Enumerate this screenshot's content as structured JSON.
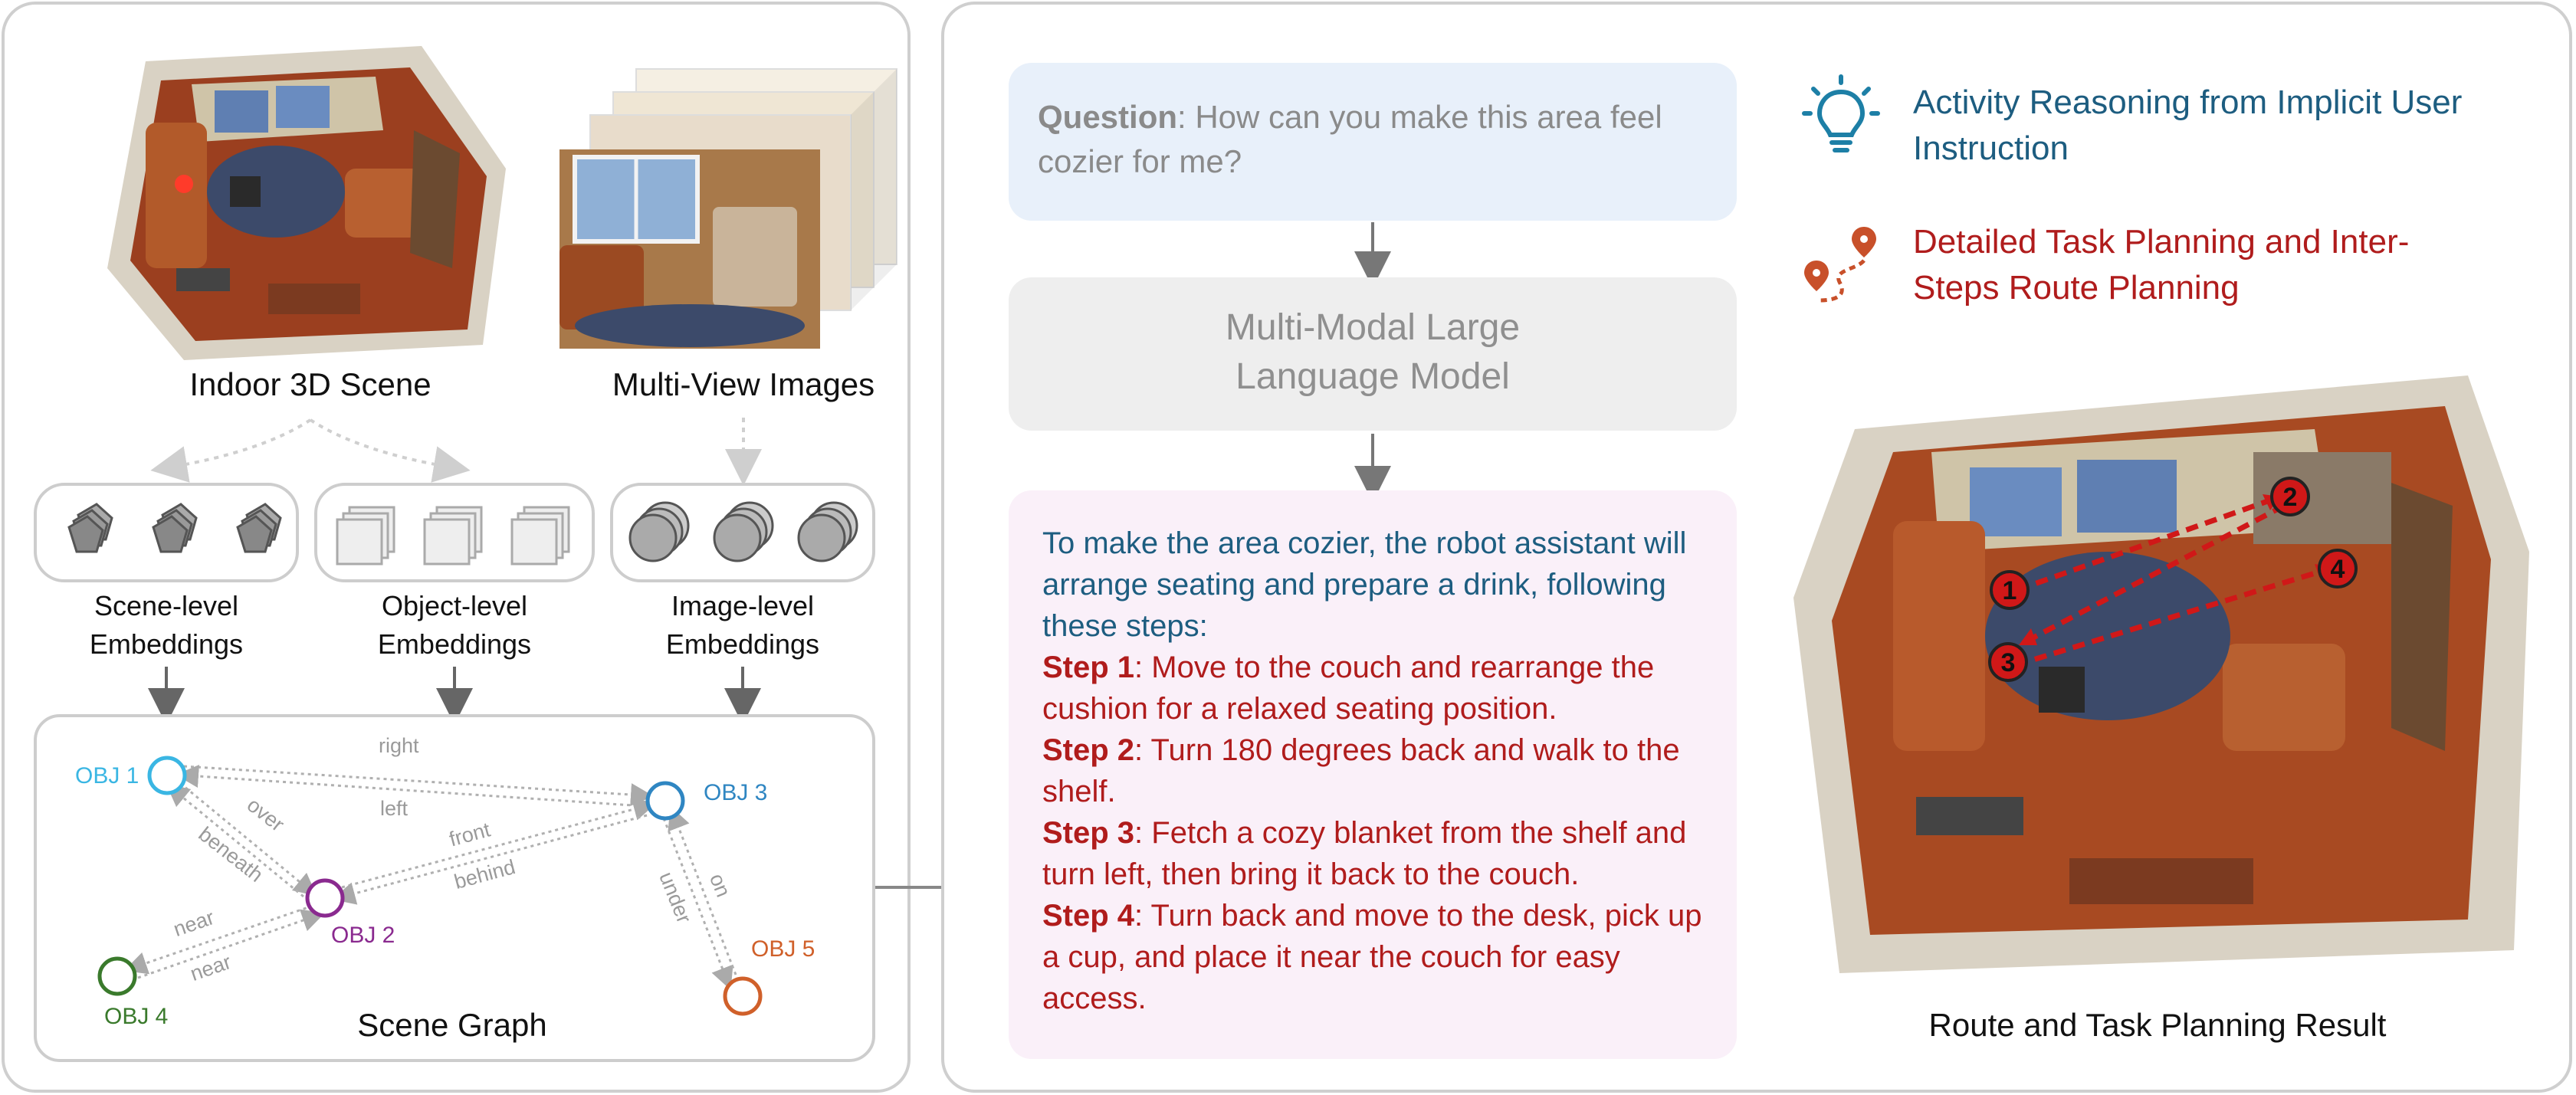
{
  "left_panel": {
    "scene_caption": "Indoor 3D Scene",
    "multiview_caption": "Multi-View Images",
    "embeddings": [
      {
        "line1": "Scene-level",
        "line2": "Embeddings"
      },
      {
        "line1": "Object-level",
        "line2": "Embeddings"
      },
      {
        "line1": "Image-level",
        "line2": "Embeddings"
      }
    ],
    "scene_graph": {
      "title": "Scene Graph",
      "nodes": [
        {
          "label": "OBJ 1",
          "color": "#3ab6e3"
        },
        {
          "label": "OBJ 2",
          "color": "#8a2a8f"
        },
        {
          "label": "OBJ 3",
          "color": "#2f86c2"
        },
        {
          "label": "OBJ 4",
          "color": "#3a7a2c"
        },
        {
          "label": "OBJ 5",
          "color": "#d0602a"
        }
      ],
      "edges": {
        "right": "right",
        "left": "left",
        "over": "over",
        "beneath": "beneath",
        "front": "front",
        "behind": "behind",
        "near_a": "near",
        "near_b": "near",
        "on": "on",
        "under": "under"
      }
    }
  },
  "right_panel": {
    "question": {
      "prefix": "Question",
      "text": ": How can you make this area feel cozier for me?"
    },
    "model_line1": "Multi-Modal Large",
    "model_line2": "Language Model",
    "answer": {
      "intro": "To make the area cozier, the robot assistant will arrange seating and prepare a drink, following these steps:",
      "steps": [
        {
          "label": "Step 1",
          "text": ": Move to the couch and rearrange the cushion for a relaxed seating position."
        },
        {
          "label": "Step 2",
          "text": ": Turn 180 degrees back and walk to the shelf."
        },
        {
          "label": "Step 3",
          "text": ": Fetch a cozy blanket from the shelf and turn left, then bring it back to the couch."
        },
        {
          "label": "Step 4",
          "text": ": Turn back and move to the desk, pick up a cup, and place it near the couch for easy access."
        }
      ]
    },
    "legend": [
      {
        "icon": "lightbulb-icon",
        "text": "Activity Reasoning from Implicit User Instruction",
        "color": "#1d5d80"
      },
      {
        "icon": "route-icon",
        "text": "Detailed Task Planning and Inter-Steps Route Planning",
        "color": "#b01c1c"
      }
    ],
    "result_caption": "Route and Task Planning Result",
    "route_markers": [
      "1",
      "2",
      "3",
      "4"
    ]
  },
  "colors": {
    "panel_border": "#cfcfcf",
    "question_bg": "#e8f0fa",
    "model_bg": "#eeeeee",
    "answer_bg": "#faf0f9",
    "intro_text": "#1d5d80",
    "step_text": "#b01c1c",
    "route_red": "#d01818"
  }
}
